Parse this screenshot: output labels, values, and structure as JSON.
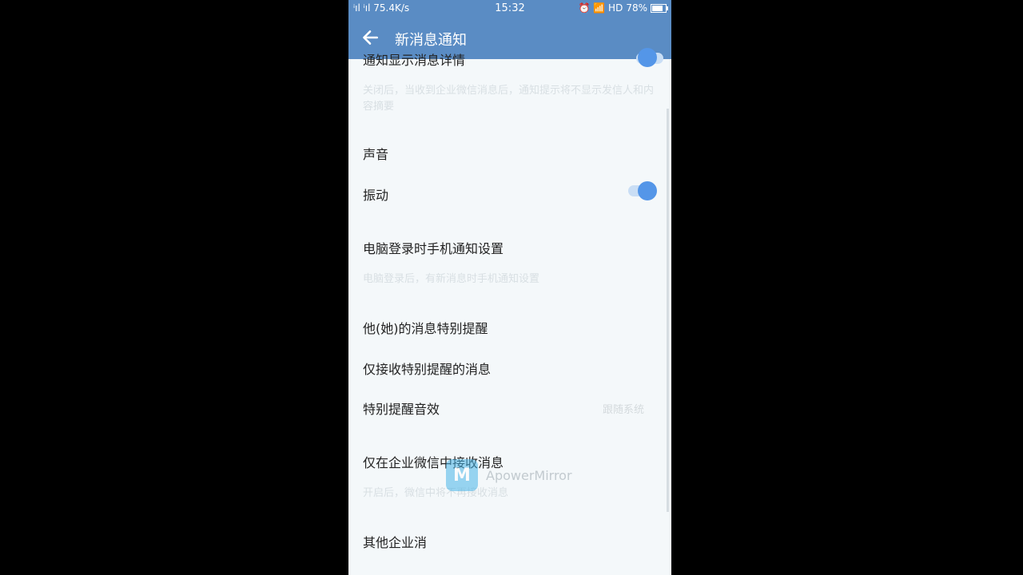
{
  "statusbar": {
    "signal": "ⁱıl ⁱıl 75.4K/s",
    "time": "15:32",
    "icons": "⏰ 📶 HD",
    "battery": "78%"
  },
  "appbar": {
    "title": "新消息通知",
    "back_icon": "arrow-left-icon"
  },
  "settings": {
    "partial_row": "通知显示消息详情",
    "partial_desc": "关闭后，当收到企业微信消息后，通知提示将不显示发信人和内容摘要",
    "sound": "声音",
    "vibrate": "振动",
    "pc_login": "电脑登录时手机通知设置",
    "pc_login_desc": "电脑登录后，有新消息时手机通知设置",
    "special_remind": "他(她)的消息特别提醒",
    "only_special": "仅接收特别提醒的消息",
    "special_sound": "特别提醒音效",
    "special_sound_value": "跟随系统",
    "only_wework": "仅在企业微信中接收消息",
    "only_wework_desc": "开启后，微信中将不再接收消息",
    "other": "其他企业消"
  },
  "watermark": {
    "text": "ApowerMirror",
    "logo": "M"
  },
  "colors": {
    "appbar": "#5a8cc4",
    "toggle": "#5496e8"
  }
}
